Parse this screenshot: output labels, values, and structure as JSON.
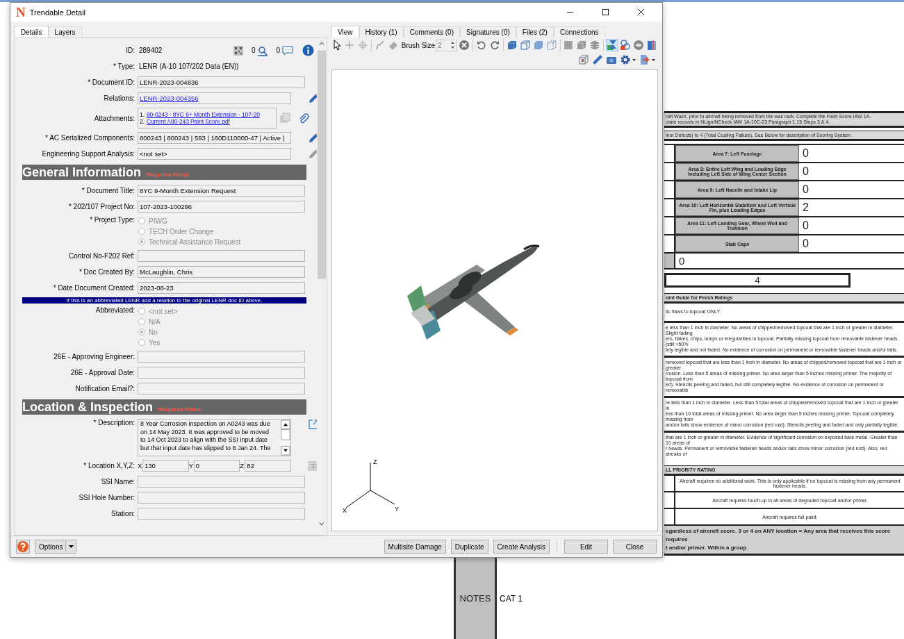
{
  "window": {
    "logo": "N",
    "title": "Trendable Detail"
  },
  "left_tabs": [
    {
      "label": "Details",
      "selected": true
    },
    {
      "label": "Layers",
      "selected": false
    }
  ],
  "form": {
    "id_row": {
      "label": "ID:",
      "value": "289402",
      "pin_count": "0",
      "comment_count": "0"
    },
    "rows": [
      {
        "kind": "static",
        "label": "* Type:",
        "value": "LENR (A-10 107/202 Data (EN))"
      },
      {
        "kind": "field",
        "label": "* Document ID:",
        "value": "LENR-2023-004836"
      },
      {
        "kind": "link",
        "label": "Relations:",
        "value": "LENR-2023-004356",
        "pencil": {
          "disabled": false
        }
      },
      {
        "kind": "attachments",
        "label": "Attachments:",
        "items": [
          {
            "number": "1.",
            "name": "80-0243 - 8YC 6+ Month Extension - 107-20"
          },
          {
            "number": "2.",
            "name": "Current A80-243 Paint Score.pdf"
          }
        ]
      },
      {
        "kind": "field",
        "label": "* AC Serialized Components:",
        "value": "800243 | 800243 | 593 | 160D110000-47 | Active |",
        "pencil": {
          "disabled": false
        }
      },
      {
        "kind": "field",
        "label": "Engineering Support Analysis:",
        "value": "<not set>",
        "pencil": {
          "disabled": true
        }
      },
      {
        "kind": "section",
        "title": "General Information",
        "note": "*Required Fields"
      },
      {
        "kind": "field",
        "label": "* Document Title:",
        "value": "8YC 9-Month Extension Request"
      },
      {
        "kind": "field",
        "label": "* 202/107 Project No:",
        "value": "107-2023-100296"
      },
      {
        "kind": "radios",
        "label": "* Project Type:",
        "disabled": true,
        "options": [
          {
            "label": "PIWG",
            "selected": false
          },
          {
            "label": "TECH Order Change",
            "selected": false
          },
          {
            "label": "Technical Assistance Request",
            "selected": true
          }
        ]
      },
      {
        "kind": "field",
        "label": "Control No-F202 Ref:"
      },
      {
        "kind": "field",
        "label": "* Doc Created By:",
        "value": "McLaughlin, Chris"
      },
      {
        "kind": "field",
        "label": "* Date Document Created:",
        "value": "2023-08-23"
      },
      {
        "kind": "banner",
        "text": "If this is an abbreviated LENR add a relation to the original LENR doc ID above."
      },
      {
        "kind": "radios",
        "label": "Abbreviated:",
        "disabled": true,
        "options": [
          {
            "label": "<not set>",
            "selected": false
          },
          {
            "label": "N/A",
            "selected": false
          },
          {
            "label": "No",
            "selected": true
          },
          {
            "label": "Yes",
            "selected": false
          }
        ]
      },
      {
        "kind": "field",
        "label": "26E - Approving Engineer:"
      },
      {
        "kind": "field",
        "label": "26E - Approval Date:"
      },
      {
        "kind": "field",
        "label": "Notification Email?:"
      },
      {
        "kind": "section",
        "title": "Location & Inspection",
        "note": "*Required Fields"
      },
      {
        "kind": "textarea",
        "label": "* Description:",
        "lines": [
          "8 Year Corrosion inspection on A0243 was due",
          "on 14 May 2023. It was approved to be moved",
          "to 14 Oct 2023 to align with the SSI input date",
          "but that input date has slipped to 8 Jan 24. The"
        ],
        "popout": true
      },
      {
        "kind": "xyz",
        "label": "* Location X,Y,Z:",
        "coords": [
          {
            "axis": "X",
            "value": "130"
          },
          {
            "axis": "Y",
            "value": "0"
          },
          {
            "axis": "Z",
            "value": "82"
          }
        ]
      },
      {
        "kind": "field",
        "label": "SSI Name:"
      },
      {
        "kind": "field",
        "label": "SSI Hole Number:"
      },
      {
        "kind": "field",
        "label": "Station:"
      }
    ]
  },
  "viewer": {
    "tabs": [
      {
        "label": "View",
        "selected": true
      },
      {
        "label": "History (1)",
        "selected": false
      },
      {
        "label": "Comments (0)",
        "selected": false
      },
      {
        "label": "Signatures (0)",
        "selected": false
      },
      {
        "label": "Files (2)",
        "selected": false
      },
      {
        "label": "Connections",
        "selected": false
      }
    ],
    "brush_label": "Brush Size",
    "brush_value": "2",
    "toolbar": [
      [
        {
          "kind": "pointer",
          "selected": false
        },
        {
          "kind": "plus",
          "selected": false
        },
        {
          "kind": "crosshair",
          "selected": false
        }
      ],
      [
        {
          "kind": "brush",
          "selected": false
        },
        {
          "kind": "eraser",
          "selected": false
        },
        {
          "kind": "brush_size"
        },
        {
          "kind": "clear",
          "selected": false
        }
      ],
      [
        {
          "kind": "undo",
          "selected": false
        },
        {
          "kind": "redo",
          "selected": false
        }
      ],
      [
        {
          "kind": "cube_solid",
          "selected": false
        },
        {
          "kind": "cube_wire",
          "selected": false
        },
        {
          "kind": "cube_shaded",
          "selected": false
        },
        {
          "kind": "cube_dotted",
          "selected": false
        }
      ],
      [
        {
          "kind": "hatch",
          "selected": false
        },
        {
          "kind": "grey_cube",
          "selected": false
        },
        {
          "kind": "layers",
          "selected": false
        }
      ],
      [
        {
          "kind": "hourglass",
          "selected": true
        },
        {
          "kind": "bucket",
          "selected": false
        },
        {
          "kind": "disc",
          "selected": false
        },
        {
          "kind": "book",
          "selected": false
        }
      ]
    ],
    "toolbar2": [
      {
        "kind": "frame_cube",
        "selected": false
      },
      {
        "kind": "ruler",
        "selected": false
      },
      {
        "kind": "camera",
        "selected": false
      },
      {
        "kind": "gear",
        "selected": false
      },
      {
        "kind": "export",
        "selected": false
      }
    ],
    "axes": {
      "z": "Z",
      "x": "X",
      "y": "Y"
    }
  },
  "footer": {
    "options": "Options",
    "buttons": [
      "Multisite Damage",
      "Duplicate",
      "Create Analysis"
    ],
    "main_buttons": [
      "Edit",
      "Close"
    ]
  },
  "sheet": {
    "instruction": [
      "raft Wash, prior to aircraft being removed from the was rack. Complete the Paint Score IAW 1A-",
      "otate records in NLign/NCheck IAW 1A-10C-23 Paragraph 1.15 Steps 3 & 4."
    ],
    "scoring": "inor Defects) to 4 (Total Coating Failure). See Below for description of Scoring System.",
    "areas": [
      {
        "label": "Area 7: Left Fuselage",
        "score": "0"
      },
      {
        "label": "Area 8: Entire Left Wing and Leading Edge Including Left Side of Wing Center Section",
        "score": "0"
      },
      {
        "label": "Area 9: Left Nacelle and Intake Lip",
        "score": "0"
      },
      {
        "label": "Area 10: Left Horizontal Stabilizer and Left Vertical Fin, plus Leading Edges",
        "score": "2"
      },
      {
        "label": "Area 11: Left Landing Gear, Wheel Well and Trunnion",
        "score": "0"
      },
      {
        "label": "Stab Caps",
        "score": "0"
      }
    ],
    "subtotal": "0",
    "total": "4",
    "guide_title": "oint Guide for Finish Ratings",
    "guide_intro": "tic flaws to topcoat ONLY.",
    "guide_paragraphs": [
      [
        "e less than 1 inch in diameter. No areas of chipped/removed topcoat that are 1 inch or greater in diameter. Slight fading",
        "ers, flakes, chips, lumps or irregularities in topcoat. Partially missing topcoat from removable fastener heads (still >50%",
        "tely legible and not faded. No evidence of corrosion on permanent or removable fastener heads and/or tails."
      ],
      [
        "removed topcoat that are less than 1 inch in diameter. No areas of chipped/removed topcoat that are 1 inch or greater",
        "rrosion. Less than 5 areas of missing primer. No area larger than 5 inches missing primer. The majority of topcoat from",
        "ed). Stencils peeling and faded, but still completely legible. No evidence of corrosion on permanent or removable"
      ],
      [
        "re less than 1 inch in diameter. Less than 5 total areas of chipped/removed topcoat that are 1 inch or greater in",
        "ess than 10 total areas of missing primer. No area larger than 5 inches missing primer. Topcoat completely missing from",
        "and/or tails show evidence of minor corrosion (red rust). Stencils peeling and faded and only partially legible."
      ],
      [
        "that are 1 inch or greater in diameter. Evidence of significant corrosion on exposed bare metal. Greater than 10 areas of",
        "r heads. Permanent or removable fastener heads and/or tails show minor corrosion (red rust). Also, red streaks of"
      ]
    ],
    "priority_title": "LL PRIORITY RATING",
    "priorities": [
      "Aircraft requires no additional work. This is only applicable if no topcoat is missing from any permanent fastener heads.",
      "Aircraft requires touch-up in all areas of degraded topcoat and/or primer.",
      "Aircraft requires full paint."
    ],
    "footnote": [
      "egardless of aircraft score. 3 or 4 on ANY location = Any area that receives this score requires",
      "t and/or primer. Within a group"
    ]
  },
  "notes": {
    "label": "NOTES",
    "value": "CAT 1"
  }
}
